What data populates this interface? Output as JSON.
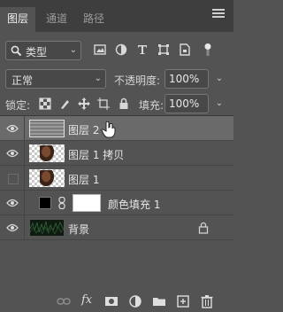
{
  "tabs": [
    {
      "label": "图层"
    },
    {
      "label": "通道"
    },
    {
      "label": "路径"
    }
  ],
  "filter": {
    "kind_label": "类型",
    "icons": [
      "image-filter-icon",
      "adjustment-filter-icon",
      "type-filter-icon",
      "shape-filter-icon",
      "smart-object-filter-icon",
      "filter-toggle-icon"
    ]
  },
  "blend": {
    "mode": "正常",
    "opacity_label": "不透明度:",
    "opacity_value": "100%"
  },
  "lock": {
    "label": "锁定:",
    "fill_label": "填充:",
    "fill_value": "100%"
  },
  "layers": [
    {
      "name": "图层 2",
      "visible": true,
      "selected": true
    },
    {
      "name": "图层 1 拷贝",
      "visible": true,
      "selected": false
    },
    {
      "name": "图层 1",
      "visible": false,
      "selected": false
    },
    {
      "name": "颜色填充 1",
      "visible": true,
      "selected": false
    },
    {
      "name": "背景",
      "visible": true,
      "selected": false,
      "locked": true
    }
  ],
  "footer_icons": [
    "link-layers-icon",
    "fx-icon",
    "add-mask-icon",
    "adjustment-layer-icon",
    "new-group-icon",
    "new-layer-icon",
    "delete-icon"
  ],
  "colors": {
    "panel_bg": "#535353",
    "tab_bar_bg": "#3e3e3e",
    "selected_row": "#6a6a6a",
    "fill_layer_color": "#000000"
  }
}
